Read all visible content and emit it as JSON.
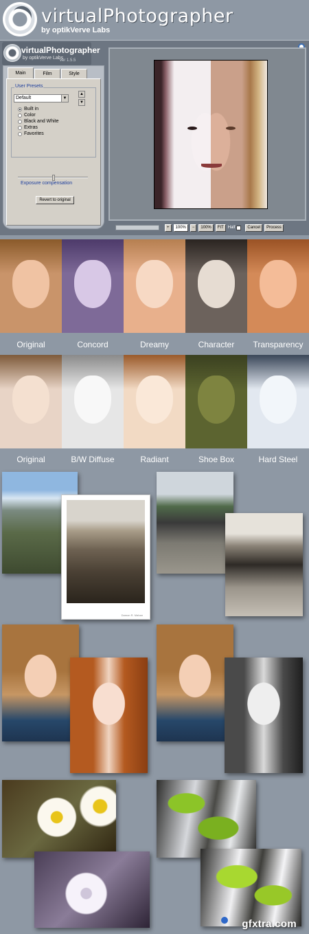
{
  "header": {
    "title": "virtualPhotographer",
    "subtitle": "by optikVerve Labs"
  },
  "app": {
    "logo_title": "virtualPhotographer",
    "logo_sub": "by optikVerve Labs",
    "logo_version": "ver 1.5.5",
    "tabs": [
      "Main",
      "Film",
      "Style"
    ],
    "group_label": "User Presets",
    "preset_value": "Default",
    "radios": [
      {
        "label": "Built in",
        "checked": true
      },
      {
        "label": "Color",
        "checked": false
      },
      {
        "label": "Black and White",
        "checked": false
      },
      {
        "label": "Extras",
        "checked": false
      },
      {
        "label": "Favorites",
        "checked": false
      }
    ],
    "exposure_label": "Exposure compensation",
    "revert_label": "Revert to original",
    "bottombar": {
      "zoom_in": "+",
      "zoom_value": "100%",
      "zoom_out": "−",
      "zoom_100": "100%",
      "fit": "FIT",
      "half_label": "Half",
      "cancel": "Cancel",
      "process": "Process"
    }
  },
  "strip1": {
    "captions": [
      "Original",
      "Concord",
      "Dreamy",
      "Character",
      "Transparency"
    ],
    "colors": [
      {
        "bg": "#c9946a",
        "hair": "#8a5a2a",
        "face": "#f0c3a3"
      },
      {
        "bg": "#7e6a98",
        "hair": "#4d3a6a",
        "face": "#d8c8e6"
      },
      {
        "bg": "#e8b08c",
        "hair": "#b57f50",
        "face": "#f7d9c4"
      },
      {
        "bg": "#6c625c",
        "hair": "#2a2420",
        "face": "#e6dcd2"
      },
      {
        "bg": "#d48a58",
        "hair": "#9a5224",
        "face": "#f4bc98"
      }
    ]
  },
  "strip2": {
    "captions": [
      "Original",
      "B/W Diffuse",
      "Radiant",
      "Shoe Box",
      "Hard Steel"
    ],
    "colors": [
      {
        "bg": "#e8d4c6",
        "hair": "#7e5a3a",
        "face": "#f4e0d0"
      },
      {
        "bg": "#e6e6e6",
        "hair": "#8a8a8a",
        "face": "#f8f8f8"
      },
      {
        "bg": "#f2dac4",
        "hair": "#9a5a2a",
        "face": "#fae8d8"
      },
      {
        "bg": "#5c6430",
        "hair": "#3a4020",
        "face": "#7e8440"
      },
      {
        "bg": "#e2e8f0",
        "hair": "#3a4658",
        "face": "#f2f6fa"
      }
    ]
  },
  "watermark": {
    "text": "gfxtra.com"
  },
  "signature": "Damon R. Mahan"
}
